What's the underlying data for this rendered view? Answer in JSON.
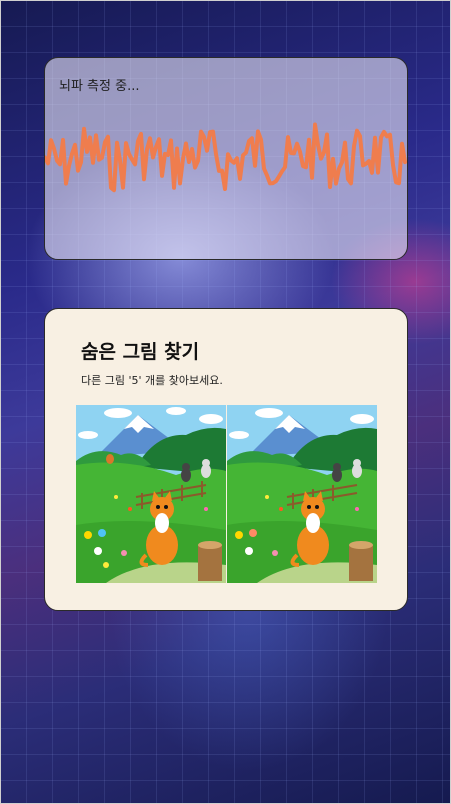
{
  "wave_card": {
    "status": "뇌파 측정 중...",
    "wave_color": "#ef7d4e"
  },
  "game_card": {
    "title": "숨은 그림 찾기",
    "instruction": "다른 그림 '5' 개를 찾아보세요.",
    "images": [
      {
        "name": "left-picture",
        "description": "original"
      },
      {
        "name": "right-picture",
        "description": "with-differences"
      }
    ]
  }
}
